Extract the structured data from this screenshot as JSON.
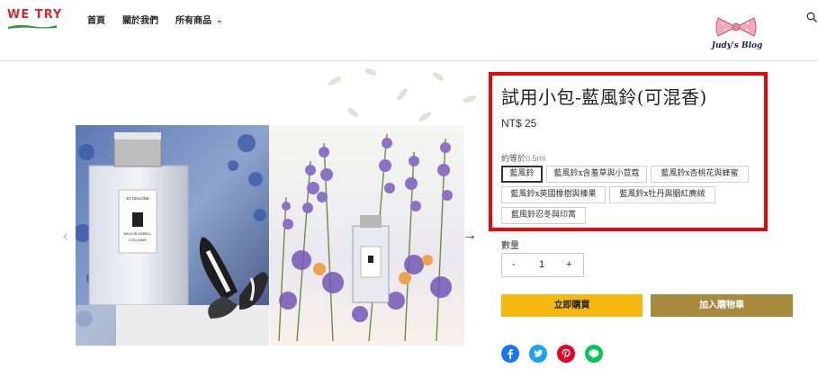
{
  "header": {
    "logo_text": "WE TRY",
    "nav": {
      "home": "首頁",
      "about": "關於我們",
      "all_products": "所有商品"
    },
    "blog_badge": "Judy's Blog"
  },
  "product": {
    "title": "試用小包-藍風鈴(可混香)",
    "price": "NT$ 25",
    "variant_label": "約等於",
    "variant_label_suffix": "0.5ml",
    "options": [
      "藍風鈴",
      "藍風鈴x含羞草與小荳蔻",
      "藍風鈴x杏桃花與蜂蜜",
      "藍風鈴x英國橡樹與榛果",
      "藍風鈴x牡丹與胭紅麂絨",
      "藍風鈴忍冬與印蒿"
    ],
    "selected_option": "藍風鈴",
    "quantity_label": "數量",
    "quantity": "1",
    "minus": "-",
    "plus": "+",
    "buy_now": "立即購買",
    "add_to_cart": "加入購物車"
  },
  "gallery": {
    "bottle_label_brand": "JO MALONE",
    "bottle_label_name": "WILD BLUEBELL",
    "bottle_label_type": "COLOGNE",
    "prev_arrow": "‹",
    "next_arrow": "→"
  },
  "share": [
    "facebook-icon",
    "twitter-icon",
    "pinterest-icon",
    "line-icon"
  ],
  "colors": {
    "highlight_border": "#e40a0a",
    "buy_button": "#f5b912",
    "cart_button": "#a88a3f",
    "facebook": "#1877f2",
    "twitter": "#1da1f2",
    "pinterest": "#e60023",
    "line": "#06c755"
  }
}
